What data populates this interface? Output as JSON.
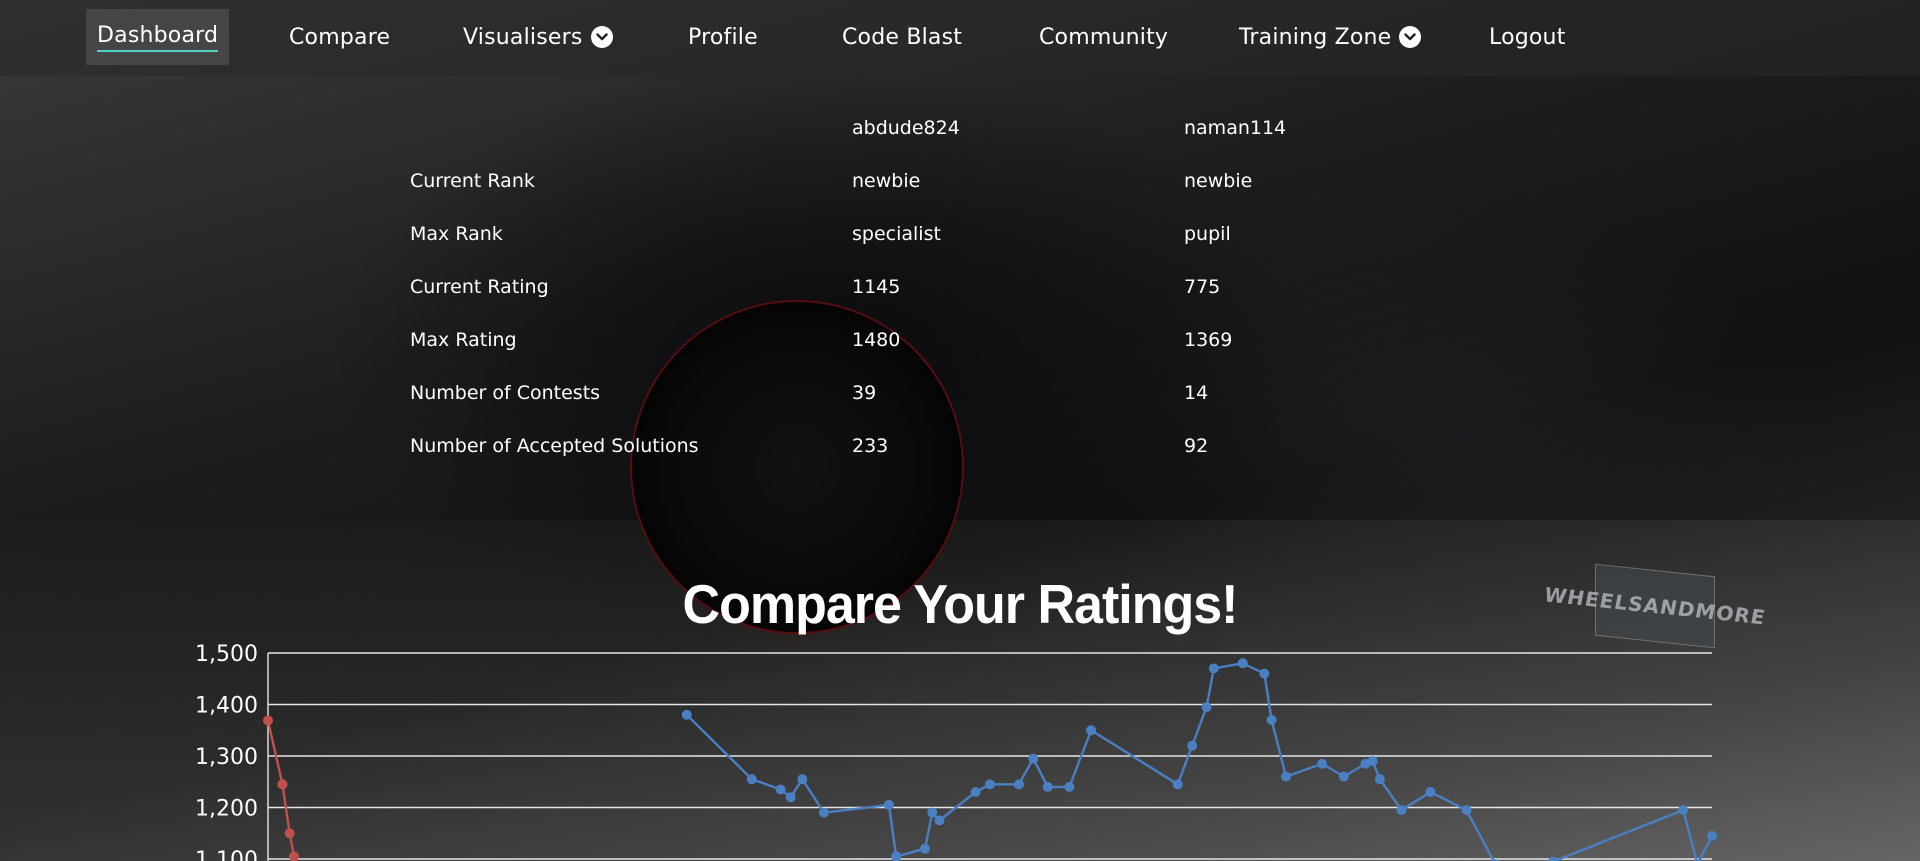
{
  "nav": {
    "items": [
      {
        "label": "Dashboard",
        "active": true
      },
      {
        "label": "Compare"
      },
      {
        "label": "Visualisers",
        "dropdown": true
      },
      {
        "label": "Profile"
      },
      {
        "label": "Code Blast"
      },
      {
        "label": "Community"
      },
      {
        "label": "Training Zone",
        "dropdown": true
      },
      {
        "label": "Logout"
      }
    ]
  },
  "compare": {
    "user1": "abdude824",
    "user2": "naman114",
    "rows": [
      {
        "label": "Current Rank",
        "u1": "newbie",
        "u2": "newbie"
      },
      {
        "label": "Max Rank",
        "u1": "specialist",
        "u2": "pupil"
      },
      {
        "label": "Current Rating",
        "u1": "1145",
        "u2": "775"
      },
      {
        "label": "Max Rating",
        "u1": "1480",
        "u2": "1369"
      },
      {
        "label": "Number of Contests",
        "u1": "39",
        "u2": "14"
      },
      {
        "label": "Number of Accepted Solutions",
        "u1": "233",
        "u2": "92"
      }
    ]
  },
  "background": {
    "plate_text": "WHEELSANDMORE"
  },
  "chart_data": {
    "type": "line",
    "title": "Compare Your Ratings!",
    "ylim": [
      1100,
      1500
    ],
    "y_ticks": [
      "1,500",
      "1,400",
      "1,300",
      "1,200",
      "1,100"
    ],
    "grid": true,
    "x_range": [
      0,
      100
    ],
    "series": [
      {
        "color": "#4a7fc1",
        "values": [
          [
            29,
            1380
          ],
          [
            33.5,
            1255
          ],
          [
            35.5,
            1235
          ],
          [
            36.2,
            1220
          ],
          [
            37,
            1255
          ],
          [
            38.5,
            1190
          ],
          [
            43,
            1205
          ],
          [
            43.5,
            1105
          ],
          [
            45.5,
            1120
          ],
          [
            46,
            1190
          ],
          [
            46.5,
            1175
          ],
          [
            49,
            1230
          ],
          [
            50,
            1245
          ],
          [
            52,
            1245
          ],
          [
            53,
            1295
          ],
          [
            54,
            1240
          ],
          [
            55.5,
            1240
          ],
          [
            57,
            1350
          ],
          [
            63,
            1245
          ],
          [
            64,
            1320
          ],
          [
            65,
            1395
          ],
          [
            65.5,
            1470
          ],
          [
            67.5,
            1480
          ],
          [
            69,
            1460
          ],
          [
            69.5,
            1370
          ],
          [
            70.5,
            1260
          ],
          [
            73,
            1285
          ],
          [
            74.5,
            1260
          ],
          [
            76,
            1285
          ],
          [
            76.5,
            1290
          ],
          [
            77,
            1255
          ],
          [
            78.5,
            1195
          ],
          [
            80.5,
            1230
          ],
          [
            83,
            1195
          ],
          [
            85,
            1090
          ],
          [
            89,
            1095
          ],
          [
            98,
            1195
          ],
          [
            99,
            1090
          ],
          [
            100,
            1145
          ]
        ]
      },
      {
        "color": "#c0504d",
        "values": [
          [
            0,
            1369
          ],
          [
            1,
            1245
          ],
          [
            1.5,
            1150
          ],
          [
            1.8,
            1105
          ],
          [
            2.2,
            1080
          ]
        ]
      }
    ]
  }
}
